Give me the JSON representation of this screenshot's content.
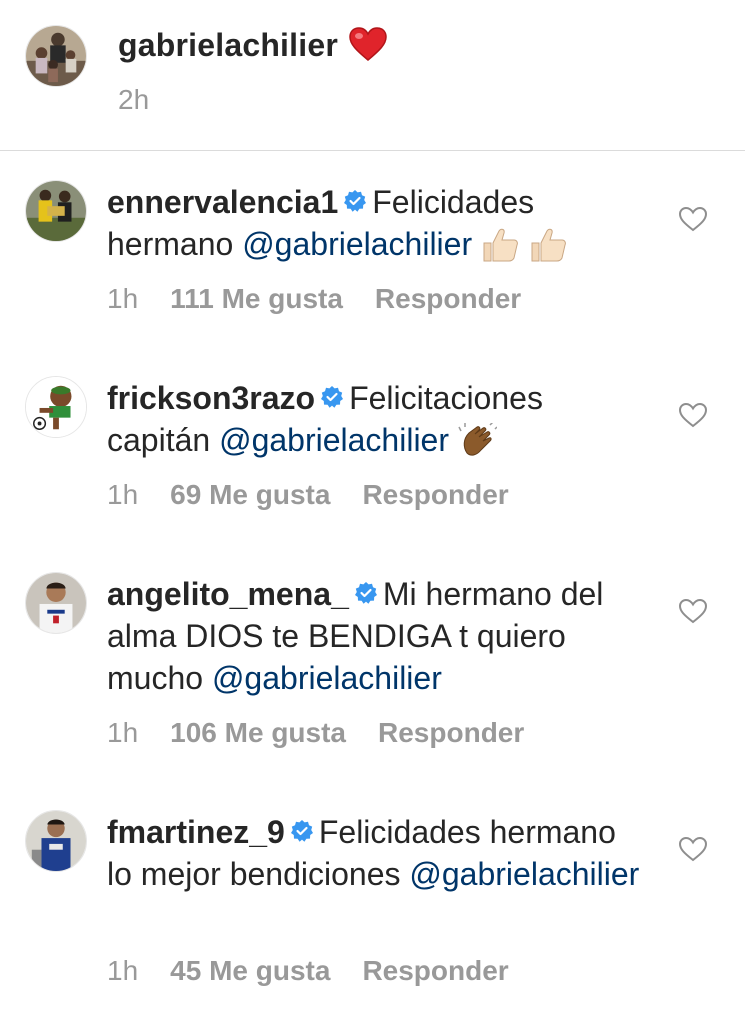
{
  "caption": {
    "username": "gabrielachilier",
    "time": "2h",
    "emoji": "red-heart"
  },
  "comments": [
    {
      "username": "ennervalencia1",
      "verified": true,
      "text_before": "Felicidades hermano",
      "mention": "@gabrielachilier",
      "text_after": "",
      "emoji": "thumbs-up x2",
      "time": "1h",
      "likes": "111 Me gusta",
      "reply": "Responder"
    },
    {
      "username": "frickson3razo",
      "verified": true,
      "text_before": "Felicitaciones capitán",
      "mention": "@gabrielachilier",
      "text_after": "",
      "emoji": "clapping-hands",
      "time": "1h",
      "likes": "69 Me gusta",
      "reply": "Responder"
    },
    {
      "username": "angelito_mena_",
      "verified": true,
      "text_before": "Mi hermano del alma DIOS te BENDIGA t quiero mucho",
      "mention": "@gabrielachilier",
      "text_after": "",
      "emoji": "",
      "time": "1h",
      "likes": "106 Me gusta",
      "reply": "Responder"
    },
    {
      "username": "fmartinez_9",
      "verified": true,
      "text_before": "Felicidades hermano lo mejor bendiciones",
      "mention": "@gabrielachilier",
      "text_after": "",
      "emoji": "",
      "time": "1h",
      "likes": "45 Me gusta",
      "reply": "Responder"
    }
  ],
  "colors": {
    "text": "#262626",
    "muted": "#999999",
    "mention": "#003569",
    "verified": "#3897f0",
    "divider": "#dbdbdb"
  }
}
